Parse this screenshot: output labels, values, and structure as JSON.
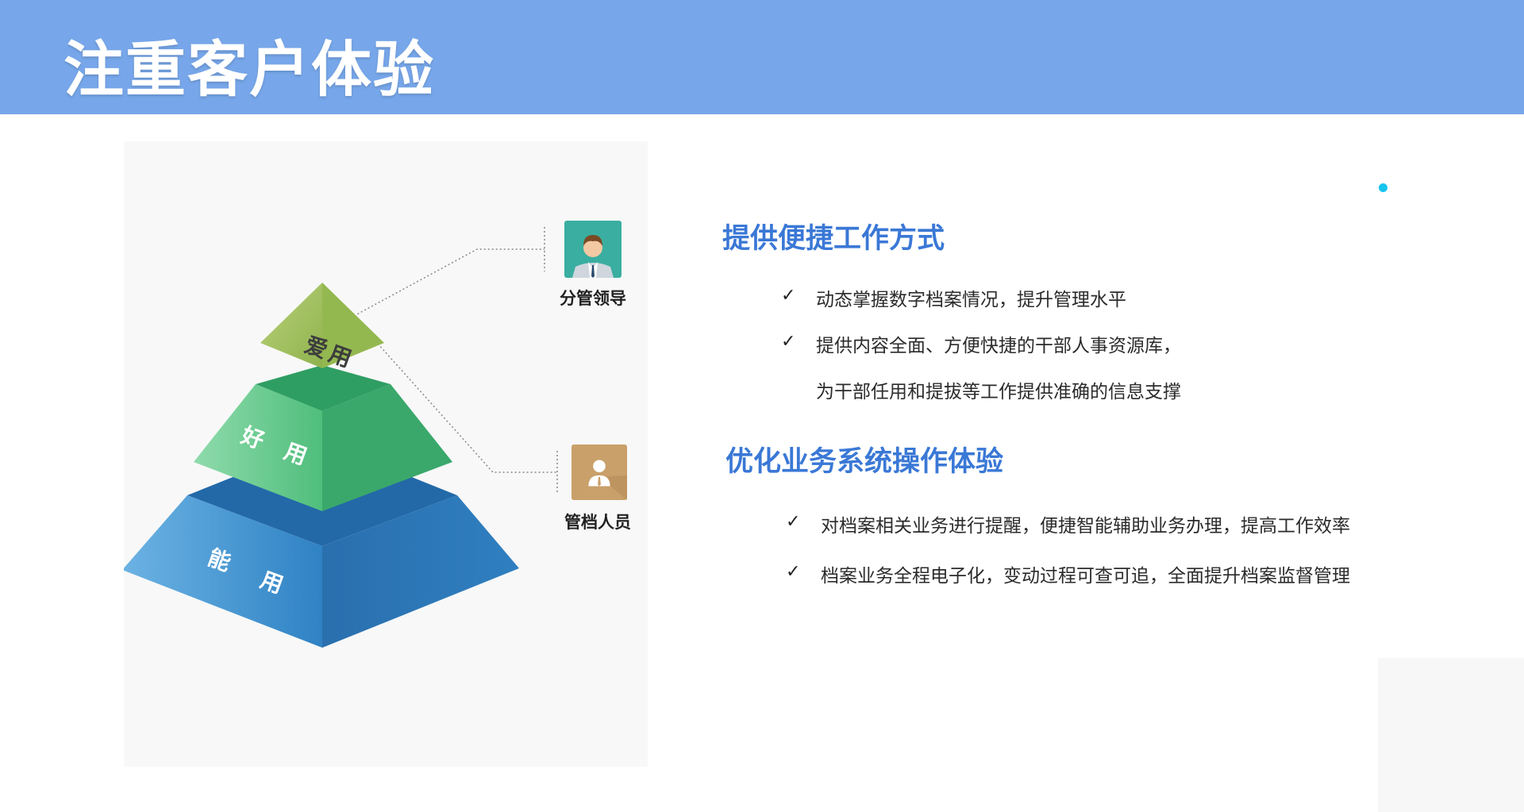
{
  "header": {
    "title": "注重客户体验"
  },
  "pyramid": {
    "top_label": "爱用",
    "middle_label_1": "好",
    "middle_label_2": "用",
    "bottom_label_1": "能",
    "bottom_label_2": "用"
  },
  "roles": [
    {
      "label": "分管领导",
      "icon": "leader-avatar-icon"
    },
    {
      "label": "管档人员",
      "icon": "staff-avatar-icon"
    }
  ],
  "sections": [
    {
      "title": "提供便捷工作方式",
      "items": [
        "动态掌握数字档案情况，提升管理水平",
        "提供内容全面、方便快捷的干部人事资源库，",
        "为干部任用和提拔等工作提供准确的信息支撑"
      ]
    },
    {
      "title": "优化业务系统操作体验",
      "items": [
        "对档案相关业务进行提醒，便捷智能辅助业务办理，提高工作效率",
        "档案业务全程电子化，变动过程可查可追，全面提升档案监督管理"
      ]
    }
  ],
  "check_symbol": "✓",
  "colors": {
    "header_bg": "#77a7ea",
    "title_blue": "#3a78d6",
    "accent_dot": "#16c4ee"
  }
}
